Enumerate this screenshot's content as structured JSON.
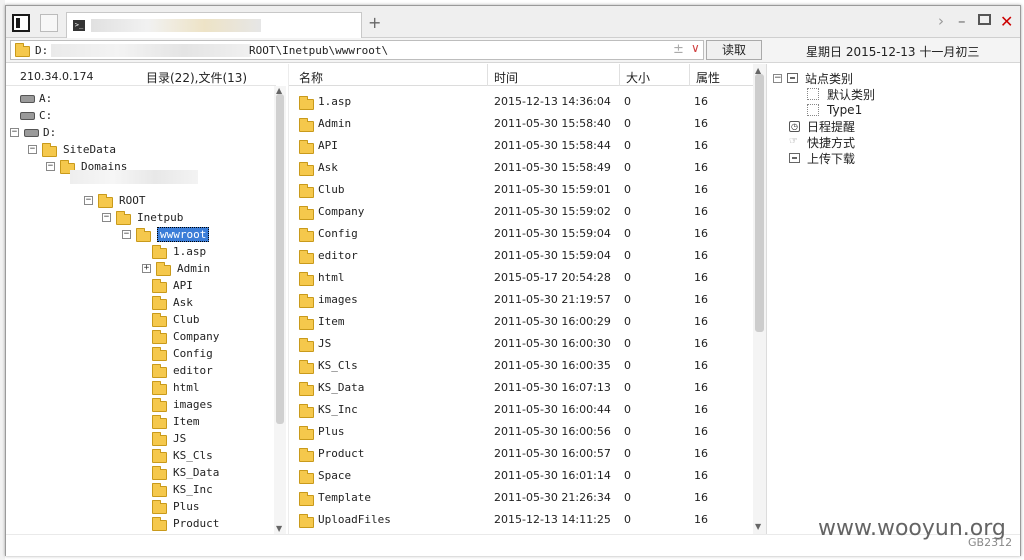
{
  "tabbar": {
    "tab_title": "",
    "add_tab": "+",
    "next": "›",
    "minimize": "–",
    "close": "✕"
  },
  "address": {
    "prefix": "D:",
    "path_tail": "ROOT\\Inetpub\\wwwroot\\",
    "plusminus": "±",
    "dropdown": "∨",
    "read_button": "读取",
    "date": "星期日  2015-12-13  十一月初三"
  },
  "tree": {
    "ip": "210.34.0.174",
    "summary": "目录(22),文件(13)",
    "items": [
      {
        "label": "A:",
        "kind": "drive",
        "expander": ""
      },
      {
        "label": "C:",
        "kind": "drive",
        "expander": ""
      },
      {
        "label": "D:",
        "kind": "drive",
        "expander": "−"
      },
      {
        "label": "SiteData",
        "kind": "folder",
        "expander": "−"
      },
      {
        "label": "Domains",
        "kind": "folder",
        "expander": "−"
      },
      {
        "label": "ROOT",
        "kind": "folder",
        "expander": "−"
      },
      {
        "label": "Inetpub",
        "kind": "folder",
        "expander": "−"
      },
      {
        "label": "wwwroot",
        "kind": "folder",
        "expander": "−"
      },
      {
        "label": "1.asp",
        "kind": "folder",
        "expander": ""
      },
      {
        "label": "Admin",
        "kind": "folder",
        "expander": "+"
      },
      {
        "label": "API",
        "kind": "folder",
        "expander": ""
      },
      {
        "label": "Ask",
        "kind": "folder",
        "expander": ""
      },
      {
        "label": "Club",
        "kind": "folder",
        "expander": ""
      },
      {
        "label": "Company",
        "kind": "folder",
        "expander": ""
      },
      {
        "label": "Config",
        "kind": "folder",
        "expander": ""
      },
      {
        "label": "editor",
        "kind": "folder",
        "expander": ""
      },
      {
        "label": "html",
        "kind": "folder",
        "expander": ""
      },
      {
        "label": "images",
        "kind": "folder",
        "expander": ""
      },
      {
        "label": "Item",
        "kind": "folder",
        "expander": ""
      },
      {
        "label": "JS",
        "kind": "folder",
        "expander": ""
      },
      {
        "label": "KS_Cls",
        "kind": "folder",
        "expander": ""
      },
      {
        "label": "KS_Data",
        "kind": "folder",
        "expander": ""
      },
      {
        "label": "KS_Inc",
        "kind": "folder",
        "expander": ""
      },
      {
        "label": "Plus",
        "kind": "folder",
        "expander": ""
      },
      {
        "label": "Product",
        "kind": "folder",
        "expander": ""
      }
    ]
  },
  "list": {
    "columns": {
      "name": "名称",
      "time": "时间",
      "size": "大小",
      "attr": "属性"
    },
    "rows": [
      {
        "name": "1.asp",
        "time": "2015-12-13 14:36:04",
        "size": "0",
        "attr": "16"
      },
      {
        "name": "Admin",
        "time": "2011-05-30 15:58:40",
        "size": "0",
        "attr": "16"
      },
      {
        "name": "API",
        "time": "2011-05-30 15:58:44",
        "size": "0",
        "attr": "16"
      },
      {
        "name": "Ask",
        "time": "2011-05-30 15:58:49",
        "size": "0",
        "attr": "16"
      },
      {
        "name": "Club",
        "time": "2011-05-30 15:59:01",
        "size": "0",
        "attr": "16"
      },
      {
        "name": "Company",
        "time": "2011-05-30 15:59:02",
        "size": "0",
        "attr": "16"
      },
      {
        "name": "Config",
        "time": "2011-05-30 15:59:04",
        "size": "0",
        "attr": "16"
      },
      {
        "name": "editor",
        "time": "2011-05-30 15:59:04",
        "size": "0",
        "attr": "16"
      },
      {
        "name": "html",
        "time": "2015-05-17 20:54:28",
        "size": "0",
        "attr": "16"
      },
      {
        "name": "images",
        "time": "2011-05-30 21:19:57",
        "size": "0",
        "attr": "16"
      },
      {
        "name": "Item",
        "time": "2011-05-30 16:00:29",
        "size": "0",
        "attr": "16"
      },
      {
        "name": "JS",
        "time": "2011-05-30 16:00:30",
        "size": "0",
        "attr": "16"
      },
      {
        "name": "KS_Cls",
        "time": "2011-05-30 16:00:35",
        "size": "0",
        "attr": "16"
      },
      {
        "name": "KS_Data",
        "time": "2011-05-30 16:07:13",
        "size": "0",
        "attr": "16"
      },
      {
        "name": "KS_Inc",
        "time": "2011-05-30 16:00:44",
        "size": "0",
        "attr": "16"
      },
      {
        "name": "Plus",
        "time": "2011-05-30 16:00:56",
        "size": "0",
        "attr": "16"
      },
      {
        "name": "Product",
        "time": "2011-05-30 16:00:57",
        "size": "0",
        "attr": "16"
      },
      {
        "name": "Space",
        "time": "2011-05-30 16:01:14",
        "size": "0",
        "attr": "16"
      },
      {
        "name": "Template",
        "time": "2011-05-30 21:26:34",
        "size": "0",
        "attr": "16"
      },
      {
        "name": "UploadFiles",
        "time": "2015-12-13 14:11:25",
        "size": "0",
        "attr": "16"
      }
    ]
  },
  "side": {
    "items": [
      {
        "label": "站点类别",
        "icon": "category-icon",
        "expander": "−"
      },
      {
        "label": "默认类别",
        "icon": "item-icon",
        "expander": ""
      },
      {
        "label": "Type1",
        "icon": "item-icon",
        "expander": ""
      },
      {
        "label": "日程提醒",
        "icon": "reminder-icon",
        "expander": ""
      },
      {
        "label": "快捷方式",
        "icon": "shortcut-icon",
        "expander": ""
      },
      {
        "label": "上传下载",
        "icon": "transfer-icon",
        "expander": ""
      }
    ]
  },
  "footer": {
    "watermark": "www.wooyun.org",
    "code": "GB2312"
  },
  "colors": {
    "selection": "#3b7dd8",
    "folder": "#f5c84c",
    "close": "#cc0000"
  }
}
